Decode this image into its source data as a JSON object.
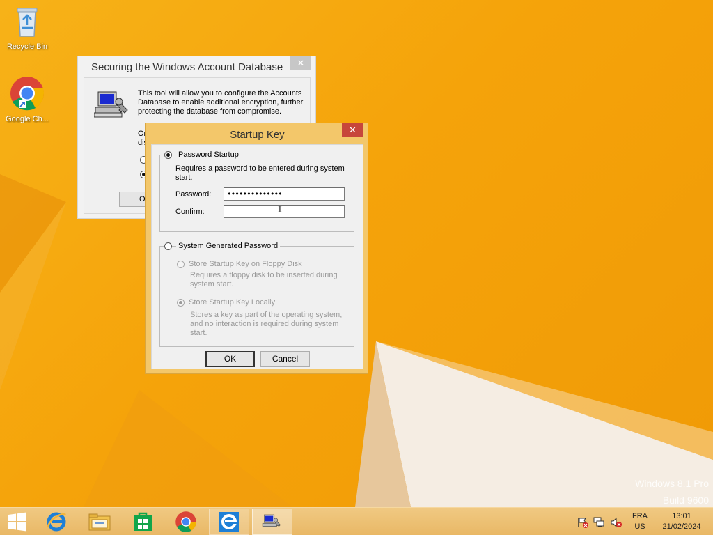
{
  "desktop": {
    "icons": [
      {
        "label": "Recycle Bin",
        "icon": "recycle-bin-icon"
      },
      {
        "label": "Google Ch...",
        "icon": "chrome-icon"
      }
    ],
    "watermark": {
      "line1": "Windows 8.1 Pro",
      "line2": "Build 9600"
    }
  },
  "bg_window": {
    "title": "Securing the Windows Account Database",
    "description": "This tool will allow you to configure the Accounts Database to enable additional encryption, further protecting the database from compromise.",
    "partial_label_1": "Or",
    "partial_label_2": "dis",
    "ok_partial": "Ol"
  },
  "dialog": {
    "title": "Startup Key",
    "close_label": "✕",
    "password_startup": {
      "label": "Password Startup",
      "selected": true,
      "description": "Requires a password to be entered during system start.",
      "password_label": "Password:",
      "password_value": "••••••••••••••",
      "confirm_label": "Confirm:",
      "confirm_value": ""
    },
    "system_generated": {
      "label": "System Generated Password",
      "selected": false,
      "floppy": {
        "label": "Store Startup Key on Floppy Disk",
        "description": "Requires a floppy disk to be inserted during system start."
      },
      "locally": {
        "label": "Store Startup Key Locally",
        "description": "Stores a key as part of the operating system, and no interaction is required during system start."
      }
    },
    "ok_label": "OK",
    "cancel_label": "Cancel"
  },
  "taskbar": {
    "items": [
      {
        "name": "start-button",
        "icon": "windows-logo-icon"
      },
      {
        "name": "internet-explorer",
        "icon": "ie-icon"
      },
      {
        "name": "file-explorer",
        "icon": "folder-icon"
      },
      {
        "name": "store",
        "icon": "store-icon"
      },
      {
        "name": "chrome",
        "icon": "chrome-icon"
      },
      {
        "name": "internet-explorer-open",
        "icon": "ie-icon"
      },
      {
        "name": "syskey-app",
        "icon": "computer-key-icon"
      }
    ],
    "lang_line1": "FRA",
    "lang_line2": "US",
    "time": "13:01",
    "date": "21/02/2024"
  }
}
